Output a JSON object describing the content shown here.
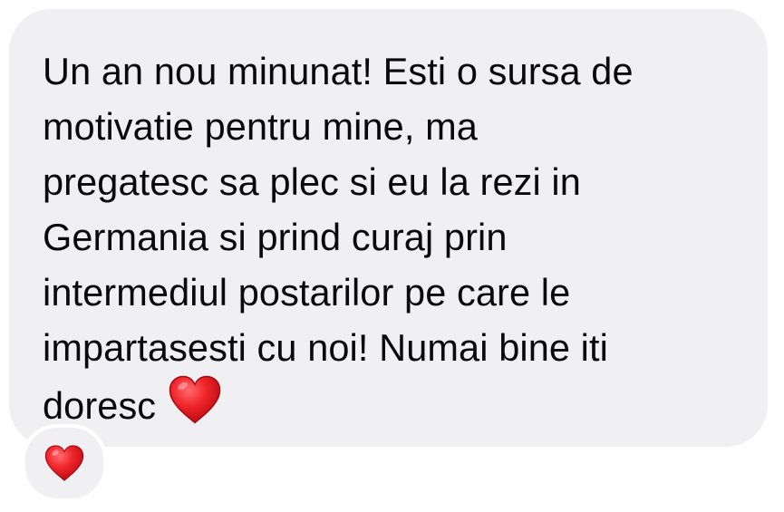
{
  "message": {
    "lines": [
      "Un an nou minunat! Esti o sursa de",
      "motivatie pentru mine, ma",
      "pregatesc sa plec si eu la rezi in",
      "Germania si prind curaj prin",
      "intermediul postarilor pe care le",
      "impartasesti cu noi! Numai bine iti",
      "doresc"
    ],
    "trailing_emoji": "red-heart-icon",
    "bubble_color": "#f0f0f2",
    "text_color": "#0a0a0a"
  },
  "reaction": {
    "emoji": "red-heart-icon",
    "heart_color": "#e8262c"
  }
}
